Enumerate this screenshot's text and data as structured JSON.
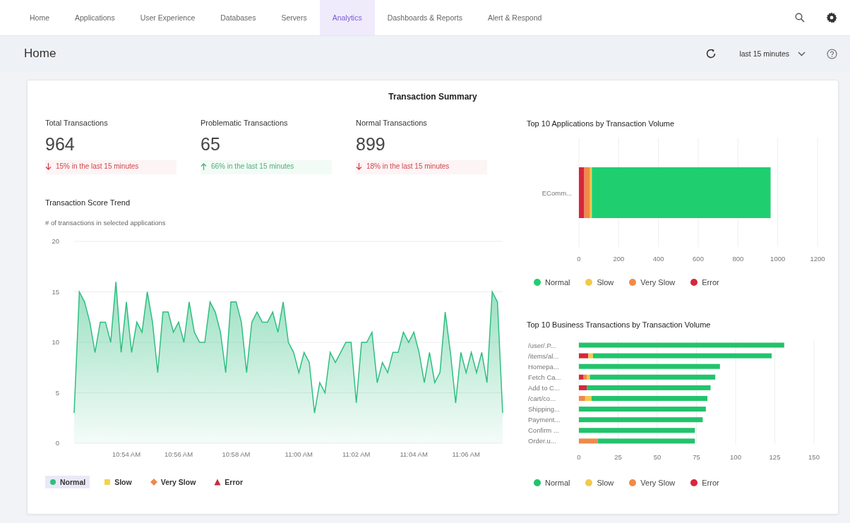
{
  "nav": {
    "tabs": [
      {
        "label": "Home",
        "selected": false
      },
      {
        "label": "Applications",
        "selected": false
      },
      {
        "label": "User Experience",
        "selected": false
      },
      {
        "label": "Databases",
        "selected": false
      },
      {
        "label": "Servers",
        "selected": false
      },
      {
        "label": "Analytics",
        "selected": true
      },
      {
        "label": "Dashboards & Reports",
        "selected": false
      },
      {
        "label": "Alert & Respond",
        "selected": false
      }
    ]
  },
  "header": {
    "title": "Home",
    "time_range": "last 15 minutes"
  },
  "summary": {
    "title": "Transaction Summary",
    "stats": [
      {
        "label": "Total Transactions",
        "value": "964",
        "kind": "decrease",
        "change": "15% in the last 15 minutes"
      },
      {
        "label": "Problematic Transactions",
        "value": "65",
        "kind": "increase",
        "change": "66% in the last 15 minutes"
      },
      {
        "label": "Normal Transactions",
        "value": "899",
        "kind": "decrease",
        "change": "18% in the last 15 minutes"
      }
    ]
  },
  "trend": {
    "title": "Transaction Score Trend",
    "subtitle": "# of transactions in selected applications",
    "chart_data": {
      "type": "area",
      "grid": true,
      "ylim": [
        0,
        20
      ],
      "yticks": [
        0,
        5,
        10,
        15,
        20
      ],
      "categories": [
        null,
        null,
        null,
        null,
        null,
        null,
        null,
        null,
        null,
        null,
        "10:54 AM",
        null,
        null,
        null,
        null,
        null,
        null,
        null,
        null,
        null,
        "10:56 AM",
        null,
        null,
        null,
        null,
        null,
        null,
        null,
        null,
        null,
        null,
        "10:58 AM",
        null,
        null,
        null,
        null,
        null,
        null,
        null,
        null,
        null,
        null,
        null,
        "11:00 AM",
        null,
        null,
        null,
        null,
        null,
        null,
        null,
        null,
        null,
        null,
        "11:02 AM",
        null,
        null,
        null,
        null,
        null,
        null,
        null,
        null,
        null,
        null,
        "11:04 AM",
        null,
        null,
        null,
        null,
        null,
        null,
        null,
        null,
        null,
        "11:06 AM",
        null,
        null,
        null,
        null,
        null,
        null,
        null
      ],
      "series": [
        {
          "color": "#2fbf80",
          "values": [
            3,
            15,
            14,
            12,
            9,
            12,
            12,
            10,
            16,
            9,
            14,
            9,
            12,
            11,
            15,
            12,
            7,
            13,
            13,
            11,
            12,
            10,
            14,
            11,
            10,
            10,
            14,
            13,
            11,
            7,
            14,
            14,
            12,
            7,
            12,
            13,
            12,
            12,
            13,
            11,
            14,
            10,
            9,
            7,
            9,
            8,
            3,
            6,
            5,
            9,
            8,
            9,
            10,
            10,
            4,
            10,
            10,
            11,
            6,
            8,
            7,
            9,
            9,
            11,
            10,
            11,
            9,
            6,
            9,
            6,
            7,
            13,
            9,
            4,
            9,
            7,
            9,
            7,
            9,
            6,
            15,
            14,
            3
          ]
        }
      ]
    },
    "legend": [
      {
        "label": "Normal",
        "kind": "circle",
        "color": "#2fbf80",
        "selected": true
      },
      {
        "label": "Slow",
        "kind": "square",
        "color": "#f3d447",
        "selected": false
      },
      {
        "label": "Very Slow",
        "kind": "diamond",
        "color": "#ee8a4a",
        "selected": false
      },
      {
        "label": "Error",
        "kind": "triangle",
        "color": "#c9283e",
        "selected": false
      }
    ]
  },
  "apps": {
    "title": "Top 10 Applications by Transaction Volume",
    "chart_data": {
      "type": "bar",
      "orientation": "horizontal",
      "stacked": true,
      "grid": true,
      "categories": [
        "EComm..."
      ],
      "xlim": [
        0,
        1200
      ],
      "xticks": [
        0,
        200,
        400,
        600,
        800,
        1000,
        1200
      ],
      "series": [
        {
          "name": "Normal",
          "color": "#1fcf6f",
          "values": [
            899
          ]
        },
        {
          "name": "Slow",
          "color": "#f2c94c",
          "values": [
            9
          ]
        },
        {
          "name": "Very Slow",
          "color": "#ef8a4a",
          "values": [
            29
          ]
        },
        {
          "name": "Error",
          "color": "#d7263d",
          "values": [
            27
          ]
        }
      ]
    }
  },
  "business": {
    "title": "Top 10 Business Transactions by Transaction Volume",
    "chart_data": {
      "type": "bar",
      "orientation": "horizontal",
      "stacked": true,
      "grid": true,
      "categories": [
        "/user/.P...",
        "/items/al...",
        "Homepa...",
        "Fetch Ca...",
        "Add to C...",
        "/cart/co...",
        "Shipping...",
        "Payment...",
        "Confirm ...",
        "Order.u..."
      ],
      "xlim": [
        0,
        150
      ],
      "xticks": [
        0,
        25,
        50,
        75,
        100,
        125,
        150
      ],
      "series": [
        {
          "name": "Normal",
          "color": "#22c36c",
          "values": [
            131,
            114,
            90,
            80,
            79,
            74,
            81,
            79,
            74,
            62
          ]
        },
        {
          "name": "Slow",
          "color": "#f2c94c",
          "values": [
            0,
            3,
            0,
            2,
            0,
            4,
            0,
            0,
            0,
            0
          ]
        },
        {
          "name": "Very Slow",
          "color": "#ef8a4a",
          "values": [
            0,
            0,
            0,
            2,
            0,
            4,
            0,
            0,
            0,
            12
          ]
        },
        {
          "name": "Error",
          "color": "#d7263d",
          "values": [
            0,
            6,
            0,
            3,
            5,
            0,
            0,
            0,
            0,
            0
          ]
        }
      ]
    }
  }
}
